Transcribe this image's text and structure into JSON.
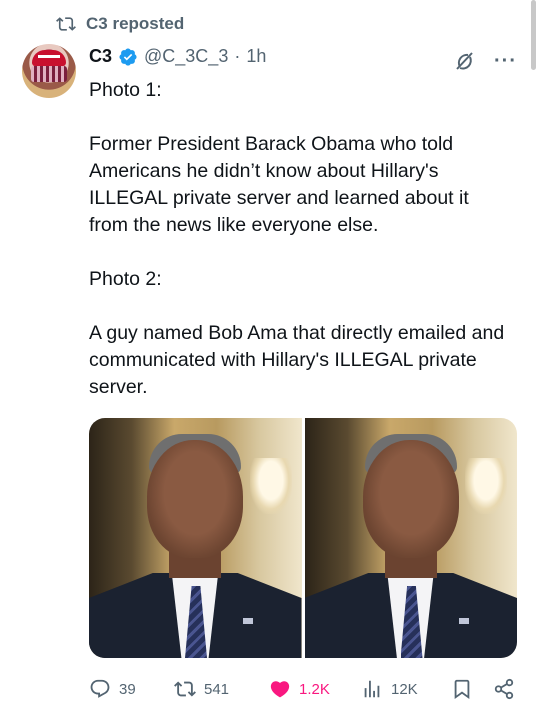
{
  "repost": {
    "label": "C3 reposted",
    "icon": "repost-icon"
  },
  "author": {
    "name": "C3",
    "handle": "@C_3C_3",
    "separator": "·",
    "time": "1h",
    "verified_color": "#1d9bf0"
  },
  "tweet": {
    "paragraphs": [
      "Photo 1:",
      "Former President Barack Obama who told Americans he didn’t know about Hillary's ILLEGAL private server and learned about it from the news like everyone else.",
      "Photo 2:",
      "A guy named Bob Ama that directly emailed and communicated with Hillary's ILLEGAL private server."
    ]
  },
  "media": {
    "count": 2
  },
  "actions": {
    "replies": "39",
    "reposts": "541",
    "likes": "1.2K",
    "views": "12K",
    "like_color": "#f91880",
    "muted_color": "#536471"
  }
}
